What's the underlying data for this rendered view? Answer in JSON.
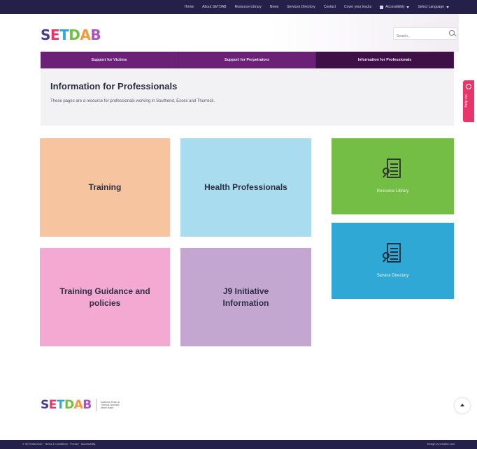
{
  "top_nav": {
    "links": [
      "Home",
      "About SETDAB",
      "Resource Library",
      "News",
      "Services Directory",
      "Contact",
      "Cover your tracks"
    ],
    "accessibility": "Accessibility",
    "language": "Select Language"
  },
  "header": {
    "logo_letters": [
      {
        "char": "S",
        "color": "#4a3a8c"
      },
      {
        "char": "E",
        "color": "#e8356b"
      },
      {
        "char": "T",
        "color": "#2fa8d6"
      },
      {
        "char": "D",
        "color": "#74be45"
      },
      {
        "char": "A",
        "color": "#f39a3c"
      },
      {
        "char": "B",
        "color": "#a857b8"
      }
    ],
    "search_placeholder": "Search..."
  },
  "tabs": [
    {
      "label": "Support for Victims",
      "active": false
    },
    {
      "label": "Support for Perpetrators",
      "active": false
    },
    {
      "label": "Information for Professionals",
      "active": true
    }
  ],
  "intro": {
    "title": "Information for Professionals",
    "text": "These pages are a resource for professionals working in Southend, Essex and Thurrock."
  },
  "help_tab": {
    "label": "Help me",
    "icon": "help-icon"
  },
  "tiles": {
    "training": "Training",
    "health": "Health Professionals",
    "guidance": "Training Guidance and policies",
    "j9": "J9 Initiative Information",
    "resource_library": "Resource Library",
    "service_directory": "Service Directory"
  },
  "footer": {
    "logo_sub": "Southend, Essex & Thurrock Domestic Abuse Board",
    "copyright": "© SETDAB 2020 · Terms & Conditions · Privacy · Accessibility",
    "credit": "Design by creative.com"
  },
  "colors": {
    "top_bar": "#24204a",
    "tab_bar": "#6b2276",
    "tab_active": "#3f1047",
    "training": "#f6c49e",
    "health": "#a9dcee",
    "guidance": "#f4a9d2",
    "j9": "#c4a7d0",
    "resource_library": "#74be45",
    "service_directory": "#2fa8d6",
    "help_tab": "#e8356b"
  }
}
